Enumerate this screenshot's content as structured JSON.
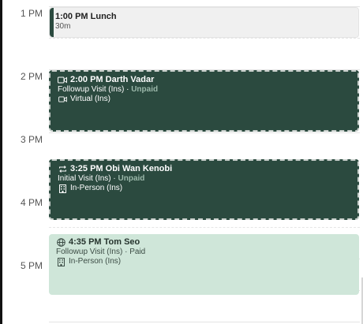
{
  "hours": [
    "1 PM",
    "2 PM",
    "3 PM",
    "4 PM",
    "5 PM"
  ],
  "events": {
    "lunch": {
      "time": "1:00 PM",
      "name": "Lunch",
      "duration": "30m"
    },
    "vadar": {
      "time": "2:00 PM",
      "name": "Darth Vadar",
      "visit_type": "Followup Visit (Ins)",
      "separator": "·",
      "status": "Unpaid",
      "location": "Virtual (Ins)",
      "icon": "video-icon",
      "location_icon": "video-icon"
    },
    "kenobi": {
      "time": "3:25 PM",
      "name": "Obi Wan Kenobi",
      "visit_type": "Initial Visit (Ins)",
      "separator": "·",
      "status": "Unpaid",
      "location": "In-Person (Ins)",
      "icon": "repeat-icon",
      "location_icon": "building-icon"
    },
    "seo": {
      "time": "4:35 PM",
      "name": "Tom Seo",
      "visit_type": "Followup Visit (Ins)",
      "separator": "·",
      "status": "Paid",
      "location": "In-Person (Ins)",
      "icon": "globe-icon",
      "location_icon": "building-icon"
    }
  },
  "colors": {
    "dark_event": "#2b4a3f",
    "light_event": "#cfe6d9",
    "lunch_bg": "#f0f0f0",
    "unpaid_text": "#9bb8aa"
  }
}
